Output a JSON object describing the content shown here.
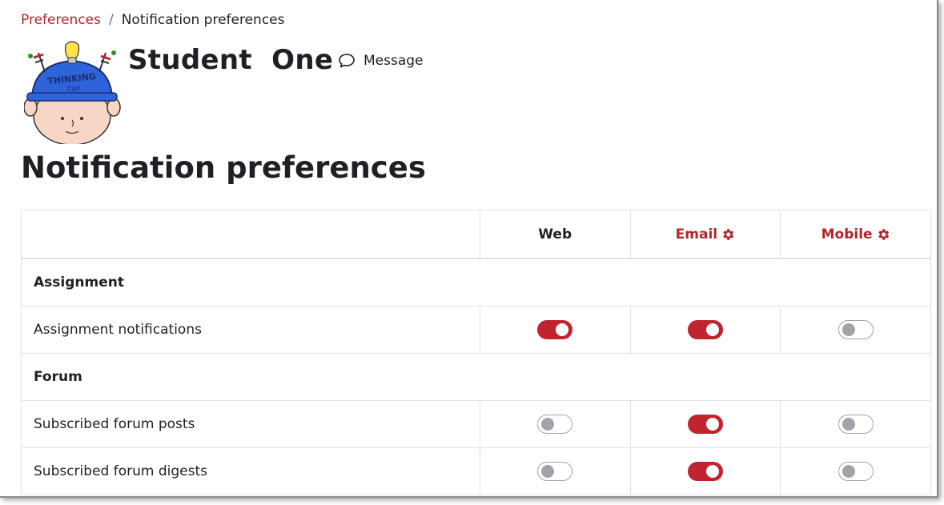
{
  "breadcrumb": {
    "parent": "Preferences",
    "separator": "/",
    "current": "Notification preferences"
  },
  "user": {
    "name": "Student  One",
    "avatar_icon": "thinking-cap-avatar",
    "avatar_text_top": "THINKING",
    "avatar_text_bottom": "CAP"
  },
  "message_link": {
    "label": "Message",
    "icon": "speech-bubble-icon"
  },
  "page": {
    "heading": "Notification preferences"
  },
  "colors": {
    "accent": "#b1262c",
    "toggle_on": "#c0252f",
    "toggle_off": "#9ea4a9"
  },
  "table": {
    "processors": [
      {
        "label": "Web",
        "has_settings": false
      },
      {
        "label": "Email",
        "has_settings": true,
        "settings_icon": "gear-icon"
      },
      {
        "label": "Mobile",
        "has_settings": true,
        "settings_icon": "gear-icon"
      }
    ],
    "groups": [
      {
        "title": "Assignment",
        "rows": [
          {
            "label": "Assignment notifications",
            "web": true,
            "email": true,
            "mobile": false
          }
        ]
      },
      {
        "title": "Forum",
        "rows": [
          {
            "label": "Subscribed forum posts",
            "web": false,
            "email": true,
            "mobile": false
          },
          {
            "label": "Subscribed forum digests",
            "web": false,
            "email": true,
            "mobile": false
          }
        ]
      }
    ]
  }
}
